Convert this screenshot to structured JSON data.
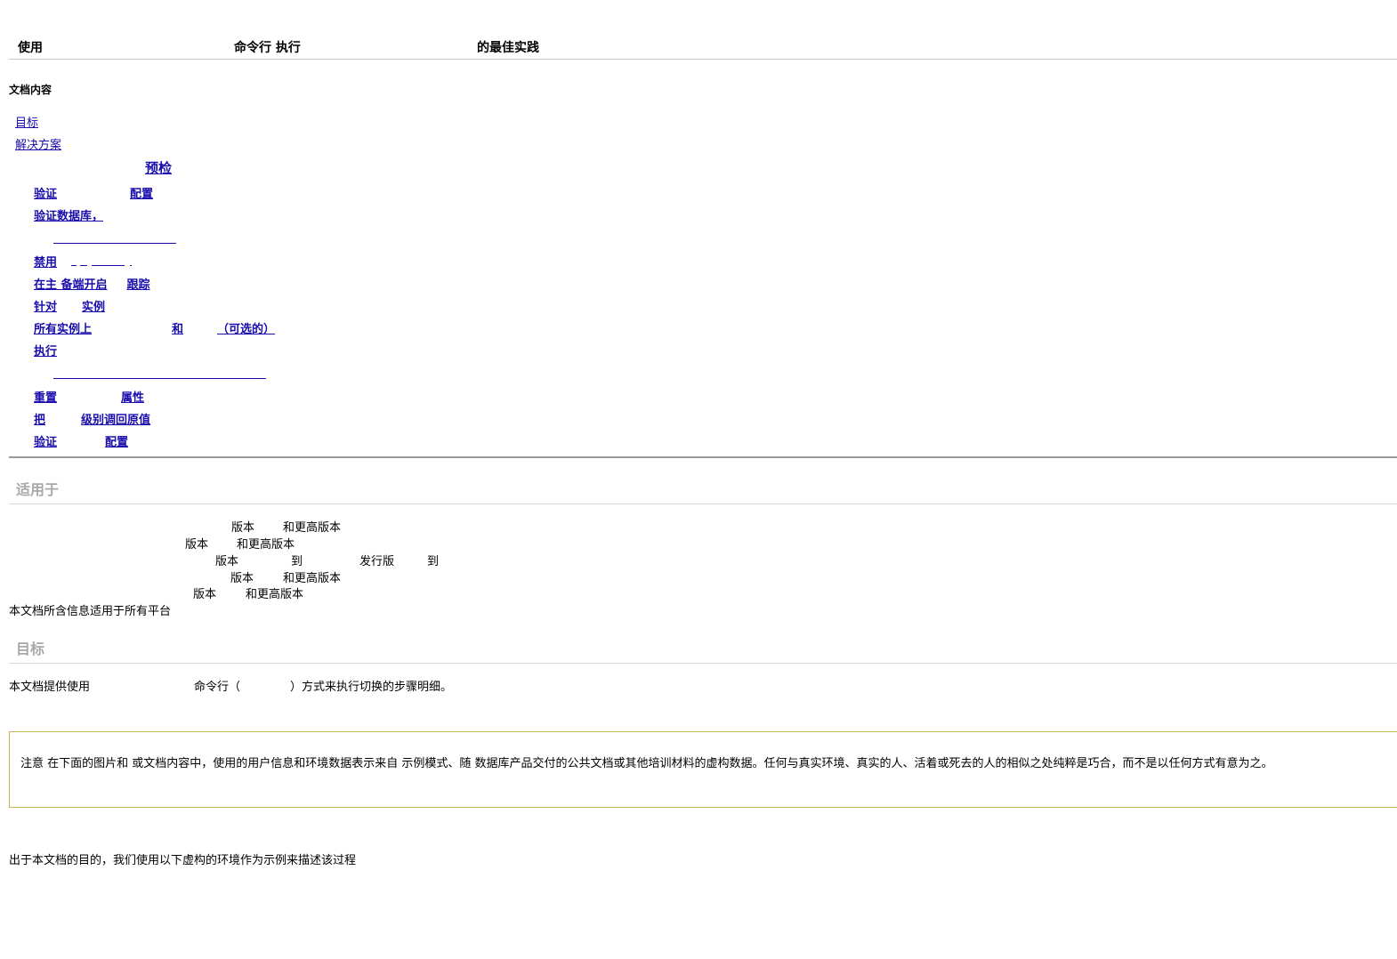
{
  "header": {
    "title_parts": [
      "使用",
      "命令行  执行",
      "的最佳实践"
    ]
  },
  "toc": {
    "heading": "文档内容",
    "top_items": [
      "目标",
      "解决方案"
    ],
    "preflight": "预检",
    "sub_items": [
      {
        "parts": [
          "验证",
          "配置"
        ]
      },
      {
        "parts": [
          "验证数据库，"
        ]
      },
      {
        "parts": [
          "禁用"
        ]
      },
      {
        "parts": [
          "在主  备端开启",
          "跟踪"
        ]
      },
      {
        "parts": [
          "针对",
          "实例"
        ]
      },
      {
        "parts": [
          "所有实例上",
          "和",
          "（可选的）"
        ]
      },
      {
        "parts": [
          "执行"
        ]
      },
      {
        "parts": [
          "重置",
          "属性"
        ]
      },
      {
        "parts": [
          "把",
          "级别调回原值"
        ]
      },
      {
        "parts": [
          "验证",
          "配置"
        ]
      }
    ]
  },
  "applies_to": {
    "heading": "适用于",
    "lines": [
      [
        "版本",
        "和更高版本"
      ],
      [
        "版本",
        "和更高版本"
      ],
      [
        "版本",
        "到",
        "发行版",
        "到"
      ],
      [
        "版本",
        "和更高版本"
      ],
      [
        "版本",
        "和更高版本"
      ]
    ],
    "platform_note": "本文档所含信息适用于所有平台"
  },
  "goal": {
    "heading": "目标",
    "parts": [
      "本文档提供使用",
      "命令行（",
      "）方式来执行切换的步骤明细。"
    ]
  },
  "note": {
    "text": "注意  在下面的图片和  或文档内容中，使用的用户信息和环境数据表示来自          示例模式、随          数据库产品交付的公共文档或其他培训材料的虚构数据。任何与真实环境、真实的人、活着或死去的人的相似之处纯粹是巧合，而不是以任何方式有意为之。"
  },
  "closing": {
    "text": "出于本文档的目的，我们使用以下虚构的环境作为示例来描述该过程"
  },
  "colors": {
    "link": "#1a0dab",
    "heading_gray": "#a8a8a8",
    "note_border": "#c8b45a"
  }
}
